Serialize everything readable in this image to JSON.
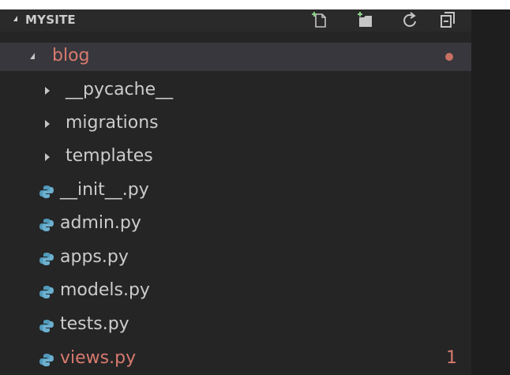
{
  "explorer": {
    "section_title": "MYSITE",
    "header_icons": [
      "new-file-icon",
      "new-folder-icon",
      "refresh-icon",
      "collapse-all-icon"
    ],
    "folder": {
      "name": "blog",
      "expanded": true,
      "status": "modified-dot"
    },
    "subfolders": [
      {
        "name": "__pycache__"
      },
      {
        "name": "migrations"
      },
      {
        "name": "templates"
      }
    ],
    "files": [
      {
        "name": "__init__.py"
      },
      {
        "name": "admin.py"
      },
      {
        "name": "apps.py"
      },
      {
        "name": "models.py"
      },
      {
        "name": "tests.py"
      },
      {
        "name": "views.py",
        "badge": "1"
      }
    ]
  },
  "colors": {
    "explorer_bg": "#252526",
    "editor_bg": "#1e1e1e",
    "selected_row": "#37373d",
    "text": "#cccccc",
    "modified": "#d87a6e",
    "python_icon": "#519aba"
  }
}
